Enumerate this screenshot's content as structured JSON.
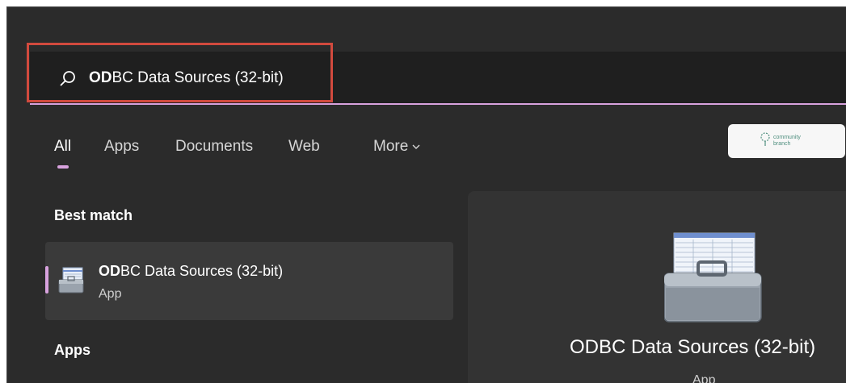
{
  "search": {
    "query_bold": "OD",
    "query_rest": "BC Data Sources (32-bit)"
  },
  "tabs": [
    {
      "label": "All"
    },
    {
      "label": "Apps"
    },
    {
      "label": "Documents"
    },
    {
      "label": "Web"
    },
    {
      "label": "More"
    }
  ],
  "brand": {
    "line1": "community",
    "line2": "branch"
  },
  "best_match": {
    "section_title": "Best match",
    "name_bold": "OD",
    "name_rest": "BC Data Sources (32-bit)",
    "type": "App"
  },
  "apps_section": {
    "title": "Apps"
  },
  "detail": {
    "name": "ODBC Data Sources (32-bit)",
    "type": "App"
  },
  "colors": {
    "accent": "#d8a2de",
    "highlight_box": "#d24a3e",
    "panel_bg": "#2b2b2b"
  },
  "icons": {
    "search": "search-icon",
    "app": "odbc-toolbox-icon",
    "more": "chevron-down-icon"
  }
}
